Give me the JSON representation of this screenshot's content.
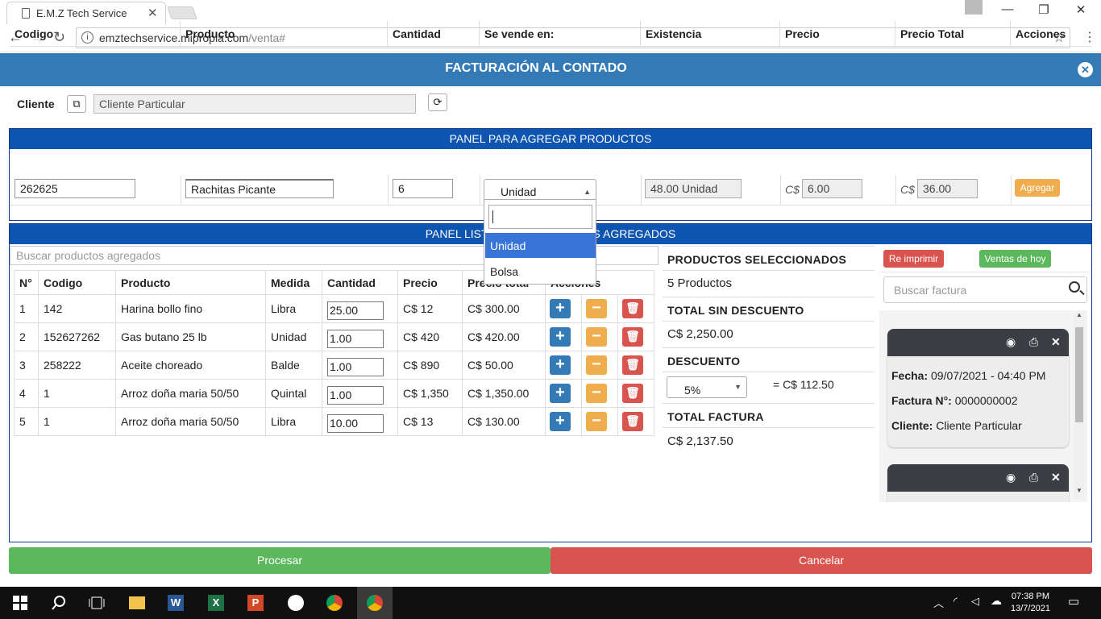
{
  "browser": {
    "tab_title": "E.M.Z Tech Service",
    "url_host": "emztechservice.mipropia.com",
    "url_path": "/venta#"
  },
  "header": {
    "title": "FACTURACIÓN AL CONTADO"
  },
  "client": {
    "label": "Cliente",
    "value": "Cliente Particular"
  },
  "add_panel": {
    "title": "PANEL PARA AGREGAR PRODUCTOS",
    "columns": [
      "Codigo",
      "Producto",
      "Cantidad",
      "Se vende en:",
      "Existencia",
      "Precio",
      "Precio Total",
      "Acciones"
    ],
    "codigo": "262625",
    "producto": "Rachitas Picante",
    "cantidad": "6",
    "se_vende_en": "Unidad",
    "existencia": "48.00 Unidad",
    "currency": "C$",
    "precio": "6.00",
    "precio_total": "36.00",
    "add_button": "Agregar"
  },
  "dropdown": {
    "options": [
      "Unidad",
      "Bolsa"
    ],
    "selected": "Unidad"
  },
  "list_panel": {
    "title_left": "PANEL LIST",
    "title_right": "S AGREGADOS",
    "search_placeholder": "Buscar productos agregados",
    "columns": [
      "N°",
      "Codigo",
      "Producto",
      "Medida",
      "Cantidad",
      "Precio",
      "Precio total",
      "Acciones"
    ],
    "rows": [
      {
        "n": "1",
        "codigo": "142",
        "producto": "Harina bollo fino",
        "medida": "Libra",
        "cantidad": "25.00",
        "precio": "C$ 12",
        "total": "C$ 300.00"
      },
      {
        "n": "2",
        "codigo": "152627262",
        "producto": "Gas butano 25 lb",
        "medida": "Unidad",
        "cantidad": "1.00",
        "precio": "C$ 420",
        "total": "C$ 420.00"
      },
      {
        "n": "3",
        "codigo": "258222",
        "producto": "Aceite choreado",
        "medida": "Balde",
        "cantidad": "1.00",
        "precio": "C$ 890",
        "total": "C$ 50.00"
      },
      {
        "n": "4",
        "codigo": "1",
        "producto": "Arroz doña maria 50/50",
        "medida": "Quintal",
        "cantidad": "1.00",
        "precio": "C$ 1,350",
        "total": "C$ 1,350.00"
      },
      {
        "n": "5",
        "codigo": "1",
        "producto": "Arroz doña maria 50/50",
        "medida": "Libra",
        "cantidad": "10.00",
        "precio": "C$ 13",
        "total": "C$ 130.00"
      }
    ]
  },
  "summary": {
    "productos_label": "PRODUCTOS SELECCIONADOS",
    "productos_value": "5 Productos",
    "sin_desc_label": "TOTAL SIN DESCUENTO",
    "sin_desc_value": "C$ 2,250.00",
    "desc_label": "DESCUENTO",
    "desc_select": "5%",
    "desc_value": "= C$ 112.50",
    "total_label": "TOTAL FACTURA",
    "total_value": "C$ 2,137.50"
  },
  "facturas": {
    "reprint_button": "Re imprimir",
    "today_button": "Ventas de hoy",
    "search_placeholder": "Buscar factura",
    "cards": [
      {
        "fecha_label": "Fecha:",
        "fecha": "09/07/2021 - 04:40 PM",
        "factura_label": "Factura N°:",
        "factura": "0000000002",
        "cliente_label": "Cliente:",
        "cliente": "Cliente Particular"
      }
    ]
  },
  "footer": {
    "procesar": "Procesar",
    "cancelar": "Cancelar"
  },
  "taskbar": {
    "time": "07:38 PM",
    "date": "13/7/2021"
  },
  "colors": {
    "header": "#337ab7",
    "panel_head": "#0d55b0",
    "success": "#5cb85c",
    "danger": "#d9534f",
    "warning": "#f0ad4e"
  }
}
